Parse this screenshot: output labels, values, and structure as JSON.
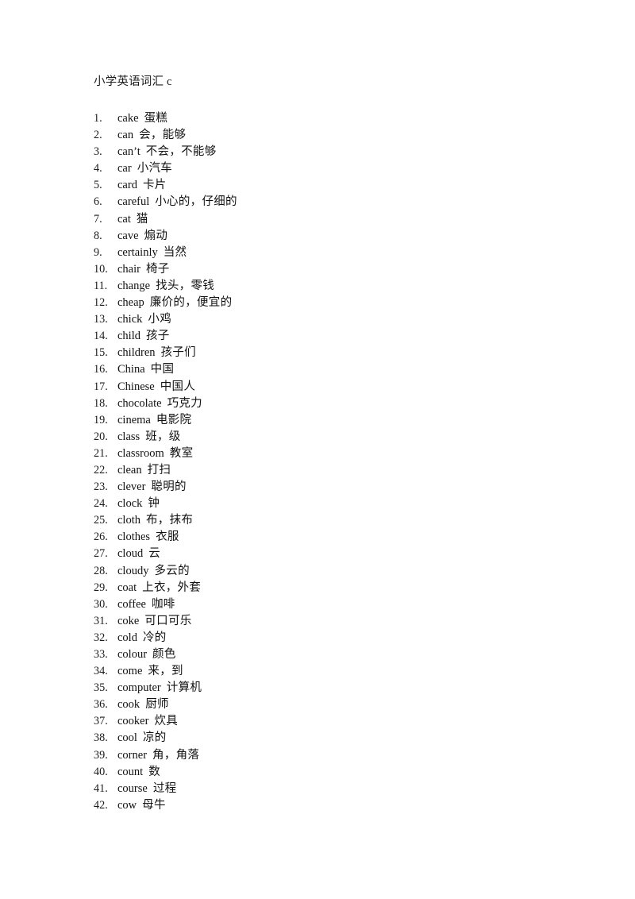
{
  "document": {
    "title": "小学英语词汇 c",
    "items": [
      {
        "index": "1.",
        "word": "cake",
        "meaning": "蛋糕"
      },
      {
        "index": "2.",
        "word": "can",
        "meaning": "会，能够"
      },
      {
        "index": "3.",
        "word": "can’t",
        "meaning": "不会，不能够"
      },
      {
        "index": "4.",
        "word": "car",
        "meaning": "小汽车"
      },
      {
        "index": "5.",
        "word": "card",
        "meaning": "卡片"
      },
      {
        "index": "6.",
        "word": "careful",
        "meaning": "小心的，仔细的"
      },
      {
        "index": "7.",
        "word": "cat",
        "meaning": "猫"
      },
      {
        "index": "8.",
        "word": "cave",
        "meaning": "煽动"
      },
      {
        "index": "9.",
        "word": "certainly",
        "meaning": "当然"
      },
      {
        "index": "10.",
        "word": "chair",
        "meaning": "椅子"
      },
      {
        "index": "11.",
        "word": "change",
        "meaning": "找头，零钱"
      },
      {
        "index": "12.",
        "word": "cheap",
        "meaning": "廉价的，便宜的"
      },
      {
        "index": "13.",
        "word": "chick",
        "meaning": "小鸡"
      },
      {
        "index": "14.",
        "word": "child",
        "meaning": "孩子"
      },
      {
        "index": "15.",
        "word": "children",
        "meaning": "孩子们"
      },
      {
        "index": "16.",
        "word": "China",
        "meaning": "中国"
      },
      {
        "index": "17.",
        "word": "Chinese",
        "meaning": "中国人"
      },
      {
        "index": "18.",
        "word": "chocolate",
        "meaning": "巧克力"
      },
      {
        "index": "19.",
        "word": "cinema",
        "meaning": "电影院"
      },
      {
        "index": "20.",
        "word": "class",
        "meaning": "班，级"
      },
      {
        "index": "21.",
        "word": "classroom",
        "meaning": "教室"
      },
      {
        "index": "22.",
        "word": "clean",
        "meaning": "打扫"
      },
      {
        "index": "23.",
        "word": "clever",
        "meaning": "聪明的"
      },
      {
        "index": "24.",
        "word": "clock",
        "meaning": "钟"
      },
      {
        "index": "25.",
        "word": "cloth",
        "meaning": "布，抹布"
      },
      {
        "index": "26.",
        "word": "clothes",
        "meaning": "衣服"
      },
      {
        "index": "27.",
        "word": "cloud",
        "meaning": "云"
      },
      {
        "index": "28.",
        "word": "cloudy",
        "meaning": "多云的"
      },
      {
        "index": "29.",
        "word": "coat",
        "meaning": "上衣，外套"
      },
      {
        "index": "30.",
        "word": "coffee",
        "meaning": "咖啡"
      },
      {
        "index": "31.",
        "word": "coke",
        "meaning": "可口可乐"
      },
      {
        "index": "32.",
        "word": "cold",
        "meaning": "冷的"
      },
      {
        "index": "33.",
        "word": "colour",
        "meaning": "颜色"
      },
      {
        "index": "34.",
        "word": "come",
        "meaning": "来，到"
      },
      {
        "index": "35.",
        "word": "computer",
        "meaning": "计算机"
      },
      {
        "index": "36.",
        "word": "cook",
        "meaning": "厨师"
      },
      {
        "index": "37.",
        "word": "cooker",
        "meaning": "炊具"
      },
      {
        "index": "38.",
        "word": "cool",
        "meaning": "凉的"
      },
      {
        "index": "39.",
        "word": "corner",
        "meaning": "角，角落"
      },
      {
        "index": "40.",
        "word": "count",
        "meaning": "数"
      },
      {
        "index": "41.",
        "word": "course",
        "meaning": "过程"
      },
      {
        "index": "42.",
        "word": "cow",
        "meaning": "母牛"
      }
    ]
  }
}
